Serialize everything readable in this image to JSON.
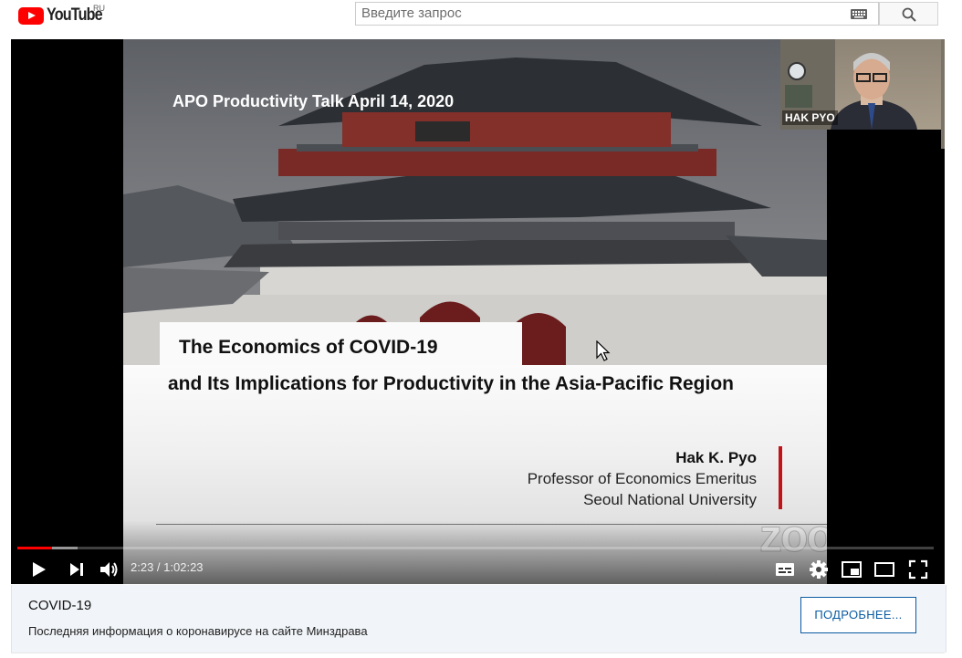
{
  "header": {
    "logo_text": "YouTube",
    "region": "RU",
    "search_placeholder": "Введите запрос"
  },
  "video": {
    "talk_title": "APO Productivity Talk April 14, 2020",
    "title_line1": "The  Economics of COVID-19",
    "title_line2": "and Its Implications for Productivity in the Asia-Pacific Region",
    "author_name": "Hak K. Pyo",
    "author_role": "Professor of Economics Emeritus",
    "author_university": "Seoul National University",
    "camera_label": "HAK PYO",
    "watermark": "zoom"
  },
  "controls": {
    "current_time": "2:23",
    "separator": " / ",
    "duration": "1:02:23",
    "progress_played_fraction": 0.038,
    "progress_loaded_fraction": 0.066
  },
  "info_card": {
    "title": "COVID-19",
    "text": "Последняя информация о коронавирусе на сайте Минздрава",
    "button_label": "ПОДРОБНЕЕ..."
  },
  "colors": {
    "brand_red": "#ff0000",
    "link_blue": "#0b5ba1",
    "slide_red_bar": "#c0141a"
  }
}
